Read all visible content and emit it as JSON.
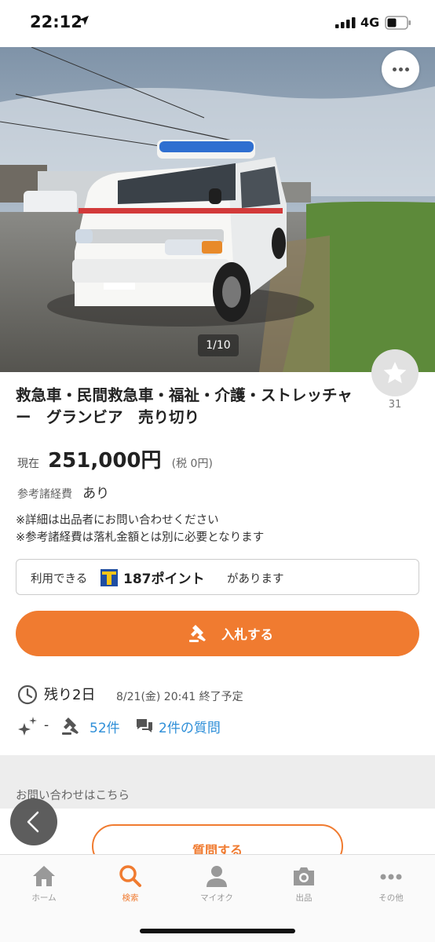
{
  "status_bar": {
    "time": "22:12",
    "network": "4G"
  },
  "gallery": {
    "counter": "1/10"
  },
  "favorite": {
    "count": "31"
  },
  "item": {
    "title": "救急車・民間救急車・福祉・介護・ストレッチャー　グランビア　売り切り"
  },
  "price": {
    "label": "現在",
    "value": "251,000円",
    "tax": "(税 0円)"
  },
  "fees": {
    "label": "参考諸経費",
    "value": "あり"
  },
  "notes": [
    "※詳細は出品者にお問い合わせください",
    "※参考諸経費は落札金額とは別に必要となります"
  ],
  "points": {
    "prefix": "利用できる",
    "amount": "187ポイント",
    "suffix": "があります"
  },
  "bid_button": {
    "label": "入札する"
  },
  "auction": {
    "remaining": "残り2日",
    "end_time": "8/21(金) 20:41 終了予定",
    "watch_dash": "-",
    "bids": "52件",
    "questions": "2件の質問"
  },
  "contact": {
    "label": "お問い合わせはこちら",
    "ask_button": "質問する"
  },
  "tabs": [
    {
      "label": "ホーム",
      "icon": "home-icon"
    },
    {
      "label": "検索",
      "icon": "search-icon",
      "active": true
    },
    {
      "label": "マイオク",
      "icon": "person-icon"
    },
    {
      "label": "出品",
      "icon": "camera-icon"
    },
    {
      "label": "その他",
      "icon": "more-icon"
    }
  ],
  "colors": {
    "accent": "#f07b30",
    "link": "#2f8fd8",
    "tpoint": "#1f4ea3"
  }
}
